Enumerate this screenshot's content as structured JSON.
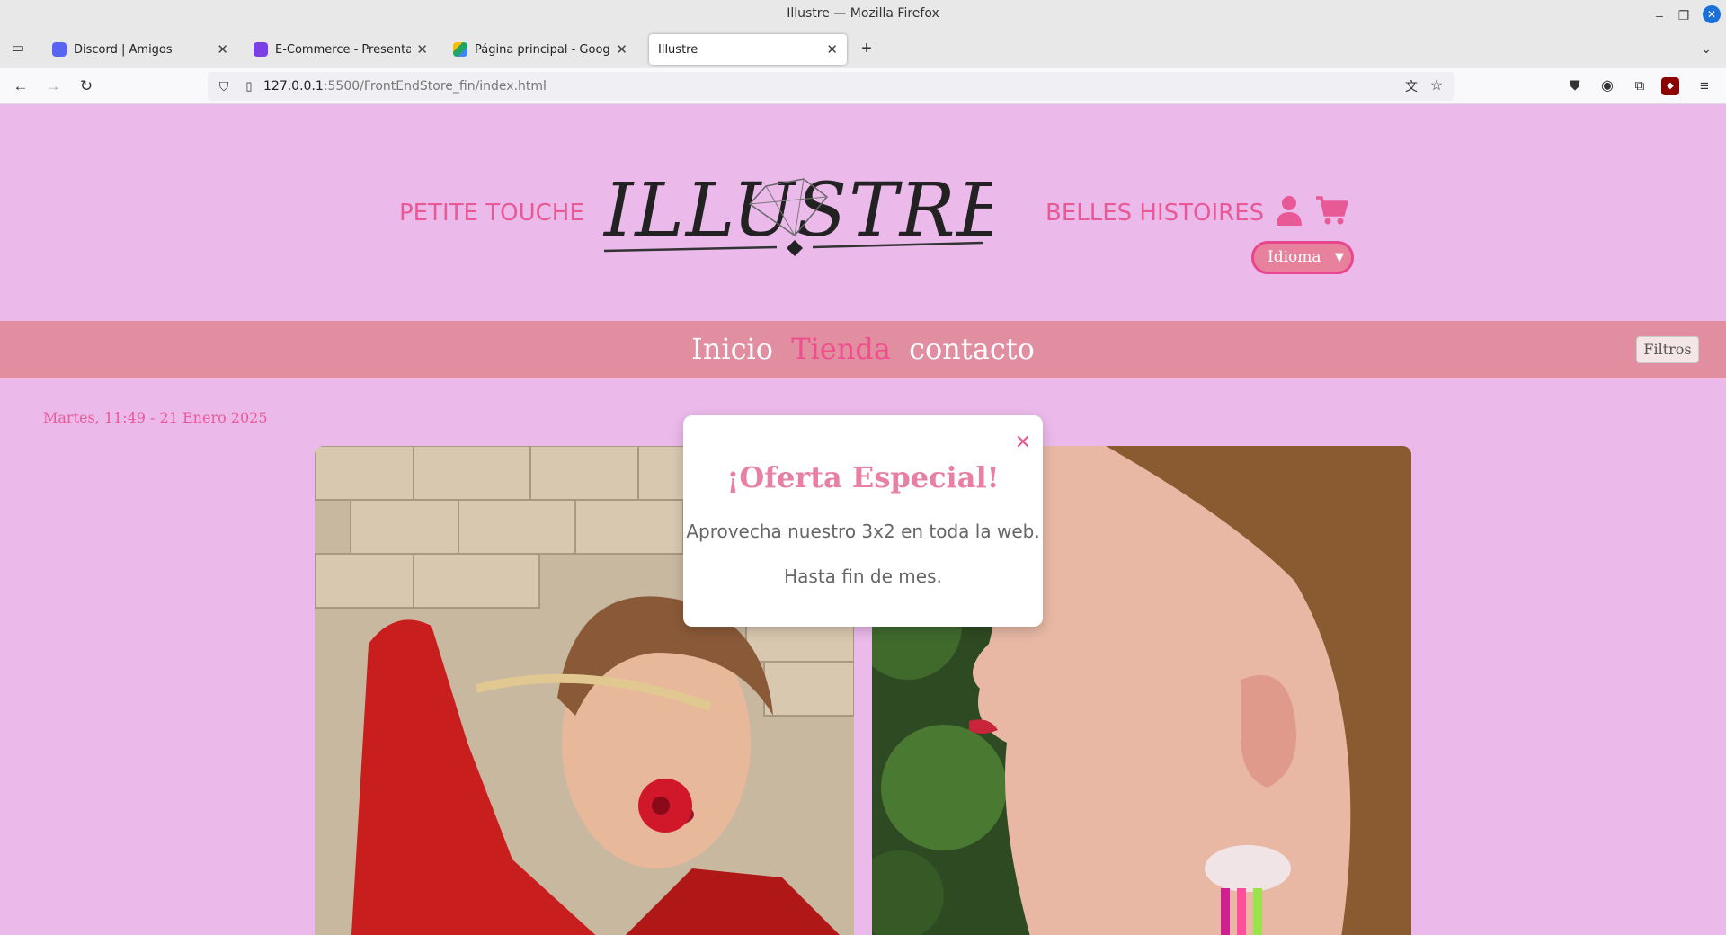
{
  "browser": {
    "window_title": "Illustre — Mozilla Firefox",
    "tabs": [
      {
        "label": "Discord | Amigos",
        "color": "#5865f2"
      },
      {
        "label": "E-Commerce - Presentación",
        "color": "#7b3fe4"
      },
      {
        "label": "Página principal - Google Dr",
        "color": "#1fa463"
      },
      {
        "label": "Illustre",
        "color": ""
      }
    ],
    "url_host": "127.0.0.1",
    "url_rest": ":5500/FrontEndStore_fin/index.html"
  },
  "site": {
    "nav_left": "PETITE TOUCHE",
    "nav_right": "BELLES HISTOIRES",
    "logo_text": "ILLUSTRE",
    "language_select": "Idioma",
    "menu": {
      "home": "Inicio",
      "shop": "Tienda",
      "contact": "contacto"
    },
    "filters_button": "Filtros",
    "date": "Martes, 11:49 - 21 Enero 2025"
  },
  "modal": {
    "title": "¡Oferta Especial!",
    "line1": "Aprovecha nuestro 3x2 en toda la web.",
    "line2": "Hasta fin de mes."
  },
  "colors": {
    "page_bg": "#ebbaeb",
    "accent": "#e85a96",
    "menubar": "#e28ea1"
  }
}
